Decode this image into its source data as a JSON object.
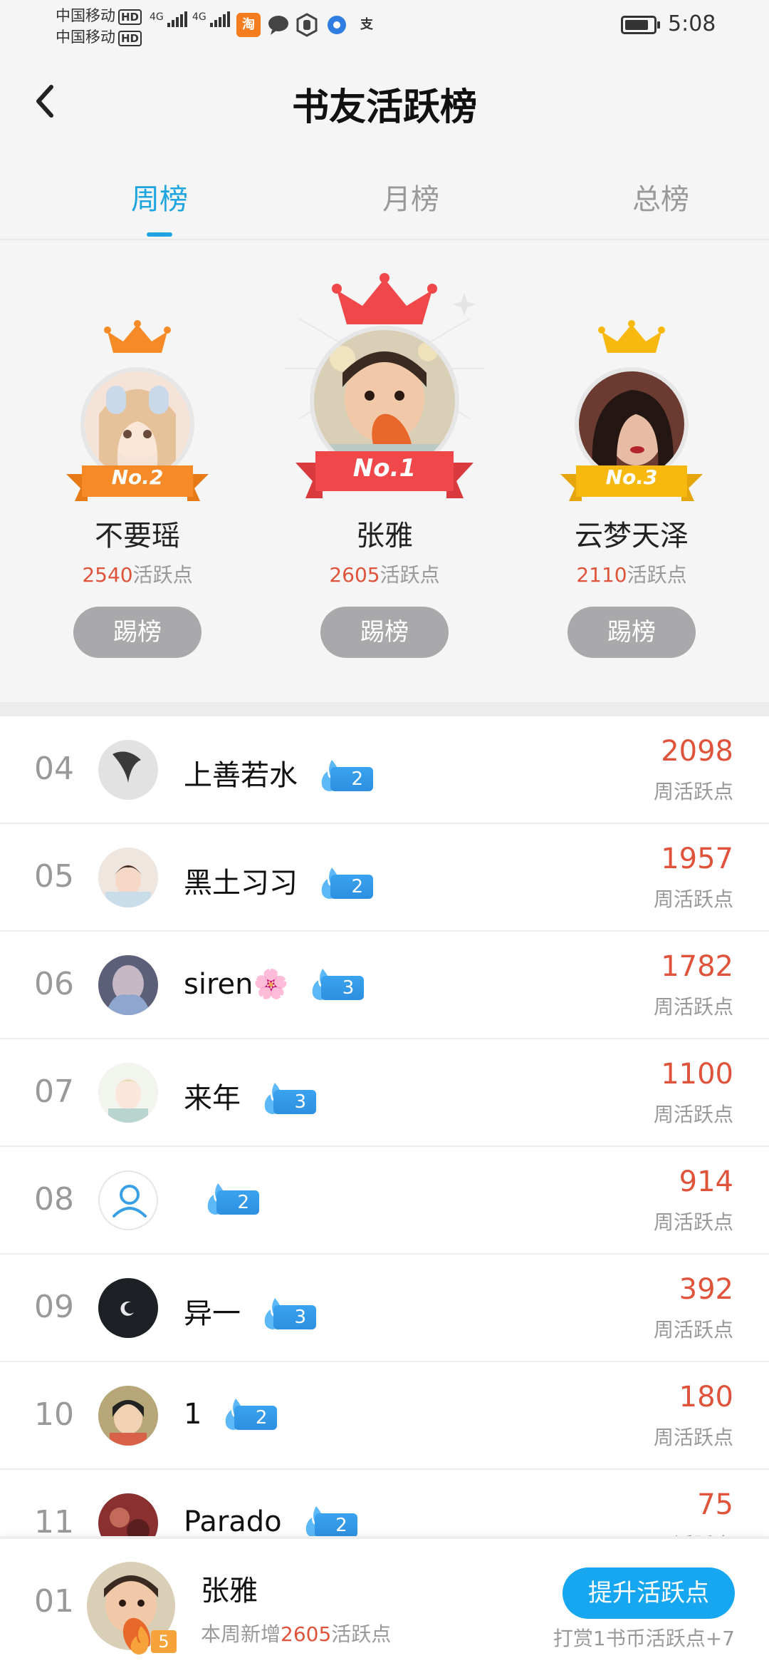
{
  "status_bar": {
    "carrier1": "中国移动",
    "carrier2": "中国移动",
    "hd": "HD",
    "net1": "4G",
    "net2": "4G",
    "taobao_icon_text": "淘",
    "alipay_icon_text": "支",
    "time": "5:08",
    "battery_level": 0.85
  },
  "header": {
    "title": "书友活跃榜"
  },
  "tabs": [
    {
      "label": "周榜",
      "active": true
    },
    {
      "label": "月榜",
      "active": false
    },
    {
      "label": "总榜",
      "active": false
    }
  ],
  "podium": {
    "first": {
      "rank_label": "No.1",
      "name": "张雅",
      "score": "2605",
      "score_unit": "活跃点",
      "button": "踢榜",
      "crown_color": "#f0484a"
    },
    "second": {
      "rank_label": "No.2",
      "name": "不要瑶",
      "score": "2540",
      "score_unit": "活跃点",
      "button": "踢榜",
      "crown_color": "#f58a26"
    },
    "third": {
      "rank_label": "No.3",
      "name": "云梦天泽",
      "score": "2110",
      "score_unit": "活跃点",
      "button": "踢榜",
      "crown_color": "#f7b80f"
    }
  },
  "list": [
    {
      "rank": "04",
      "name": "上善若水",
      "level": "2",
      "score": "2098",
      "unit": "周活跃点",
      "avatar_color": "#c8c8c8"
    },
    {
      "rank": "05",
      "name": "黑土习习",
      "level": "2",
      "score": "1957",
      "unit": "周活跃点",
      "avatar_color": "#e9ddd6"
    },
    {
      "rank": "06",
      "name": "siren🌸",
      "level": "3",
      "score": "1782",
      "unit": "周活跃点",
      "avatar_color": "#6b6b7e"
    },
    {
      "rank": "07",
      "name": "来年",
      "level": "3",
      "score": "1100",
      "unit": "周活跃点",
      "avatar_color": "#dfe8d8"
    },
    {
      "rank": "08",
      "name": "",
      "level": "2",
      "score": "914",
      "unit": "周活跃点",
      "avatar_color": "#ffffff"
    },
    {
      "rank": "09",
      "name": "异一",
      "level": "3",
      "score": "392",
      "unit": "周活跃点",
      "avatar_color": "#1d2126"
    },
    {
      "rank": "10",
      "name": "1",
      "level": "2",
      "score": "180",
      "unit": "周活跃点",
      "avatar_color": "#9a8a5a"
    },
    {
      "rank": "11",
      "name": "Parado",
      "level": "2",
      "score": "75",
      "unit": "周活跃点",
      "avatar_color": "#8a3030"
    }
  ],
  "bottom_bar": {
    "rank": "01",
    "name": "张雅",
    "level": "5",
    "desc_prefix": "本周新增",
    "desc_num": "2605",
    "desc_suffix": "活跃点",
    "button": "提升活跃点",
    "tip": "打赏1书币活跃点+7"
  },
  "colors": {
    "accent": "#1ea5e0",
    "score": "#e0533b",
    "button_blue": "#17a6f0",
    "kick_button": "#a9a9ab"
  }
}
